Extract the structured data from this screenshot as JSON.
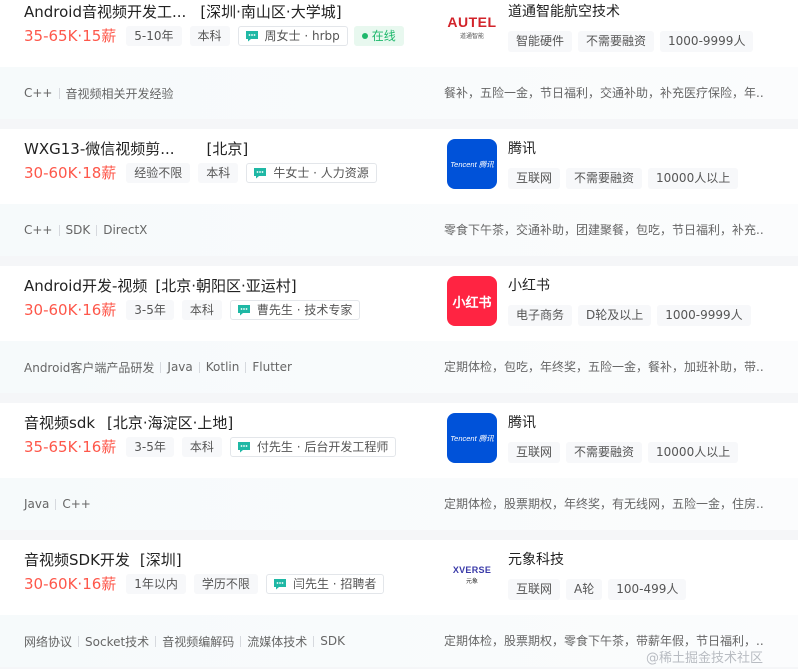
{
  "colors": {
    "salary": "#fe574a",
    "online": "#1fb86c",
    "tencent_blue": "#0052d9",
    "xhs_red": "#ff2442",
    "autel_red": "#d2232a"
  },
  "jobs": [
    {
      "title": "Android音视频开发工...",
      "area": "[深圳·南山区·大学城]",
      "salary": "35-65K·15薪",
      "tags": [
        "5-10年",
        "本科"
      ],
      "recruiter": "周女士 · hrbp",
      "online": "在线",
      "skills": [
        "C++",
        "音视频相关开发经验"
      ],
      "company": {
        "name": "道通智能航空技术",
        "logo": "autel-logo",
        "logo_text": "AUTEL",
        "logo_sub": "道通智能",
        "tags": [
          "智能硬件",
          "不需要融资",
          "1000-9999人"
        ]
      },
      "welfare": "餐补，五险一金，节日福利，交通补助，补充医疗保险，年..."
    },
    {
      "title": "WXG13-微信视频剪...",
      "area": "[北京]",
      "salary": "30-60K·18薪",
      "tags": [
        "经验不限",
        "本科"
      ],
      "recruiter": "牛女士 · 人力资源",
      "skills": [
        "C++",
        "SDK",
        "DirectX"
      ],
      "company": {
        "name": "腾讯",
        "logo": "tencent-logo",
        "logo_text": "Tencent 腾讯",
        "tags": [
          "互联网",
          "不需要融资",
          "10000人以上"
        ]
      },
      "welfare": "零食下午茶，交通补助，团建聚餐，包吃，节日福利，补充..."
    },
    {
      "title": "Android开发-视频",
      "area": "[北京·朝阳区·亚运村]",
      "salary": "30-60K·16薪",
      "tags": [
        "3-5年",
        "本科"
      ],
      "recruiter": "曹先生 · 技术专家",
      "skills": [
        "Android客户端产品研发",
        "Java",
        "Kotlin",
        "Flutter"
      ],
      "company": {
        "name": "小红书",
        "logo": "xiaohongshu-logo",
        "logo_text": "小红书",
        "tags": [
          "电子商务",
          "D轮及以上",
          "1000-9999人"
        ]
      },
      "welfare": "定期体检，包吃，年终奖，五险一金，餐补，加班补助，带..."
    },
    {
      "title": "音视频sdk",
      "area": "[北京·海淀区·上地]",
      "salary": "35-65K·16薪",
      "tags": [
        "3-5年",
        "本科"
      ],
      "recruiter": "付先生 · 后台开发工程师",
      "skills": [
        "Java",
        "C++"
      ],
      "company": {
        "name": "腾讯",
        "logo": "tencent-logo",
        "logo_text": "Tencent 腾讯",
        "tags": [
          "互联网",
          "不需要融资",
          "10000人以上"
        ]
      },
      "welfare": "定期体检，股票期权，年终奖，有无线网，五险一金，住房..."
    },
    {
      "title": "音视频SDK开发",
      "area": "[深圳]",
      "salary": "30-60K·16薪",
      "tags": [
        "1年以内",
        "学历不限"
      ],
      "recruiter": "闫先生 · 招聘者",
      "skills": [
        "网络协议",
        "Socket技术",
        "音视频编解码",
        "流媒体技术",
        "SDK"
      ],
      "company": {
        "name": "元象科技",
        "logo": "xverse-logo",
        "logo_text": "XVERSE",
        "logo_sub": "元象",
        "tags": [
          "互联网",
          "A轮",
          "100-499人"
        ]
      },
      "welfare": "定期体检，股票期权，零食下午茶，带薪年假，节日福利，..."
    }
  ],
  "watermark": "@稀土掘金技术社区"
}
